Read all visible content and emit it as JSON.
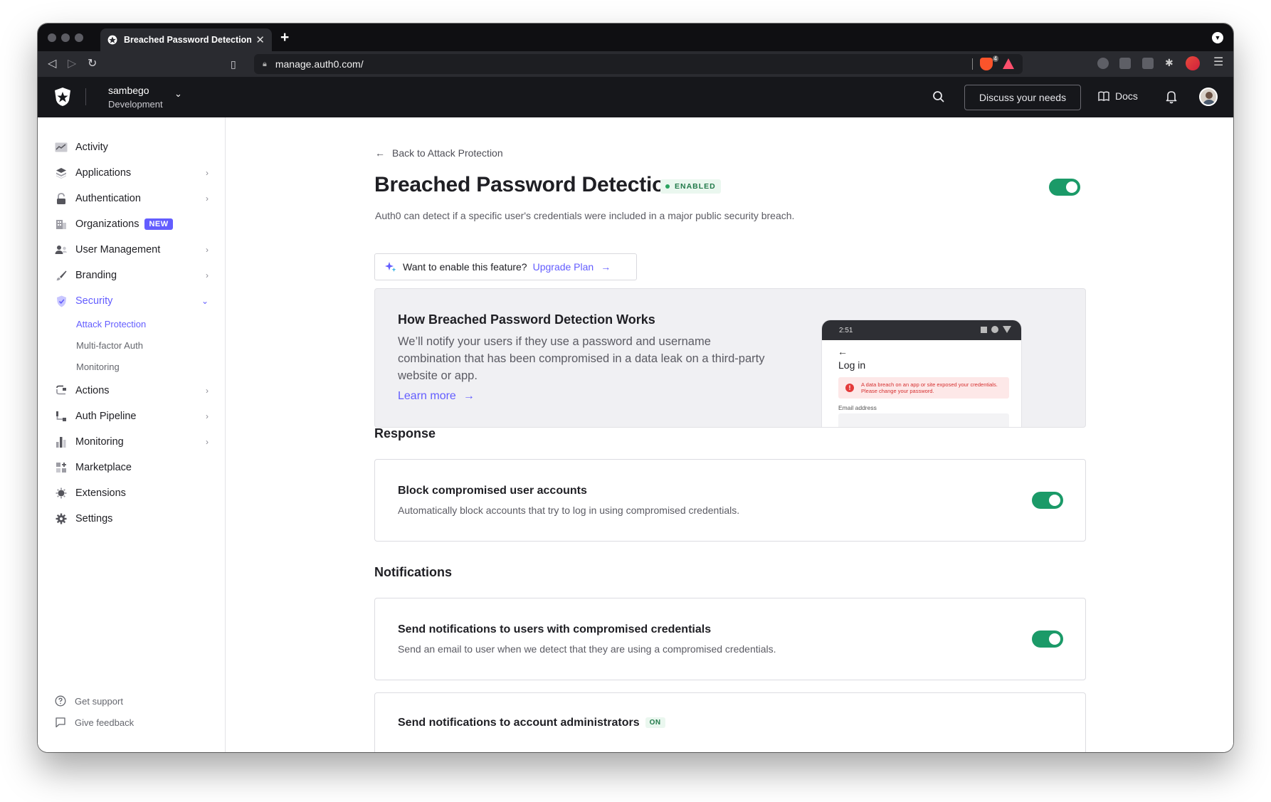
{
  "browser": {
    "tab_title": "Breached Password Detection",
    "tab_close": "✕",
    "new_tab": "+",
    "url": "manage.auth0.com/",
    "brave_shield_count": "4"
  },
  "header": {
    "tenant_name": "sambego",
    "tenant_env": "Development",
    "discuss_label": "Discuss your needs",
    "docs_label": "Docs"
  },
  "sidebar": {
    "items": [
      {
        "label": "Activity",
        "icon": "activity-icon",
        "has_chevron": false
      },
      {
        "label": "Applications",
        "icon": "applications-icon",
        "has_chevron": true
      },
      {
        "label": "Authentication",
        "icon": "lock-icon",
        "has_chevron": true
      },
      {
        "label": "Organizations",
        "icon": "building-icon",
        "has_chevron": false,
        "badge": "NEW"
      },
      {
        "label": "User Management",
        "icon": "users-icon",
        "has_chevron": true
      },
      {
        "label": "Branding",
        "icon": "brush-icon",
        "has_chevron": true
      },
      {
        "label": "Security",
        "icon": "shield-icon",
        "has_chevron": true,
        "active": true
      },
      {
        "label": "Actions",
        "icon": "actions-icon",
        "has_chevron": true
      },
      {
        "label": "Auth Pipeline",
        "icon": "pipeline-icon",
        "has_chevron": true
      },
      {
        "label": "Monitoring",
        "icon": "bar-chart-icon",
        "has_chevron": true
      },
      {
        "label": "Marketplace",
        "icon": "marketplace-icon",
        "has_chevron": false
      },
      {
        "label": "Extensions",
        "icon": "extensions-icon",
        "has_chevron": false
      },
      {
        "label": "Settings",
        "icon": "gear-icon",
        "has_chevron": false
      }
    ],
    "security_sub": [
      "Attack Protection",
      "Multi-factor Auth",
      "Monitoring"
    ],
    "footer": {
      "support": "Get support",
      "feedback": "Give feedback"
    }
  },
  "main": {
    "back_link": "Back to Attack Protection",
    "title": "Breached Password Detection",
    "status": "ENABLED",
    "enabled": true,
    "description": "Auth0 can detect if a specific user's credentials were included in a major public security breach.",
    "upgrade_prompt": "Want to enable this feature?",
    "upgrade_link": "Upgrade Plan",
    "how": {
      "title": "How Breached Password Detection Works",
      "body": "We’ll notify your users if they use a password and username combination that has been compromised in a data leak on a third-party website or app.",
      "learn_more": "Learn more"
    },
    "phone": {
      "time": "2:51",
      "title": "Log in",
      "alert": "A data breach on an app or site exposed your credentials. Please change your password.",
      "email_label": "Email address"
    },
    "response": {
      "section_title": "Response",
      "block_title": "Block compromised user accounts",
      "block_desc": "Automatically block accounts that try to log in using compromised credentials.",
      "block_enabled": true
    },
    "notifications": {
      "section_title": "Notifications",
      "users_title": "Send notifications to users with compromised credentials",
      "users_desc": "Send an email to user when we detect that they are using a compromised credentials.",
      "users_enabled": true,
      "admins_title": "Send notifications to account administrators",
      "admins_badge": "ON"
    }
  },
  "colors": {
    "accent": "#635dff",
    "toggle_on": "#1b9a68",
    "header_bg": "#16171b"
  }
}
